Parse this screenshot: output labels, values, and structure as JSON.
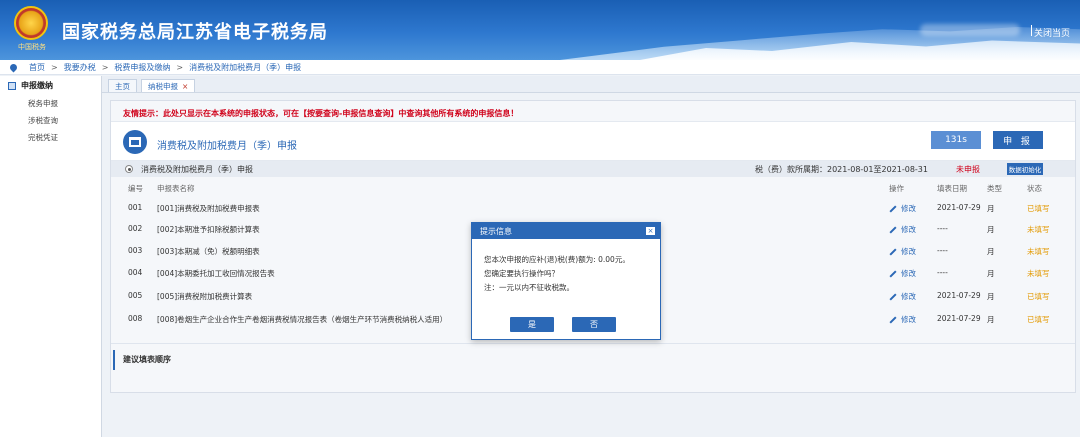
{
  "header": {
    "emblem_text": "中国税务",
    "title": "国家税务总局江苏省电子税务局",
    "close_link": "关闭当页"
  },
  "breadcrumb": {
    "items": [
      "首页",
      "我要办税",
      "税费申报及缴纳",
      "消费税及附加税费月（季）申报"
    ],
    "separator": ">"
  },
  "sidebar": {
    "heading": "申报缴纳",
    "items": [
      "税务申报",
      "涉税查询",
      "完税凭证"
    ]
  },
  "tabs": [
    {
      "label": "主页"
    },
    {
      "label": "纳税申报",
      "close": "×"
    }
  ],
  "main": {
    "notice": "友情提示：此处只显示在本系统的申报状态，可在【按要查询-申报信息查询】中查询其他所有系统的申报信息！",
    "form_title": "消费税及附加税费月（季）申报",
    "timer": "131s",
    "submit_label": "申 报",
    "period_name": "消费税及附加税费月（季）申报",
    "period_range": "税（费）款所属期：2021-08-01至2021-08-31",
    "period_status": "未申报",
    "data_button": "数据初始化",
    "columns": [
      "编号",
      "申报表名称",
      "操作",
      "填表日期",
      "类型",
      "状态"
    ],
    "rows": [
      {
        "no": "001",
        "name": "[001]消费税及附加税费申报表",
        "op": "修改",
        "date": "2021-07-29",
        "type": "月",
        "status": "已填写"
      },
      {
        "no": "002",
        "name": "[002]本期准予扣除税额计算表",
        "op": "修改",
        "date": "----",
        "type": "月",
        "status": "未填写"
      },
      {
        "no": "003",
        "name": "[003]本期减（免）税额明细表",
        "op": "修改",
        "date": "----",
        "type": "月",
        "status": "未填写"
      },
      {
        "no": "004",
        "name": "[004]本期委托加工收回情况报告表",
        "op": "修改",
        "date": "----",
        "type": "月",
        "status": "未填写"
      },
      {
        "no": "005",
        "name": "[005]消费税附加税费计算表",
        "op": "修改",
        "date": "2021-07-29",
        "type": "月",
        "status": "已填写"
      },
      {
        "no": "008",
        "name": "[008]卷烟生产企业合作生产卷烟消费税情况报告表（卷烟生产环节消费税纳税人适用）",
        "op": "修改",
        "date": "2021-07-29",
        "type": "月",
        "status": "已填写"
      }
    ],
    "suggest": "建议填表顺序"
  },
  "modal": {
    "title": "提示信息",
    "close": "×",
    "line1": "您本次申报的应补(退)税(费)额为: 0.00元。",
    "line2": "您确定要执行操作吗？",
    "line3": "注：一元以内不征收税款。",
    "yes": "是",
    "no": "否"
  },
  "colors": {
    "brand": "#2b68b6",
    "alert": "#d0021b",
    "status": "#e39b06"
  }
}
